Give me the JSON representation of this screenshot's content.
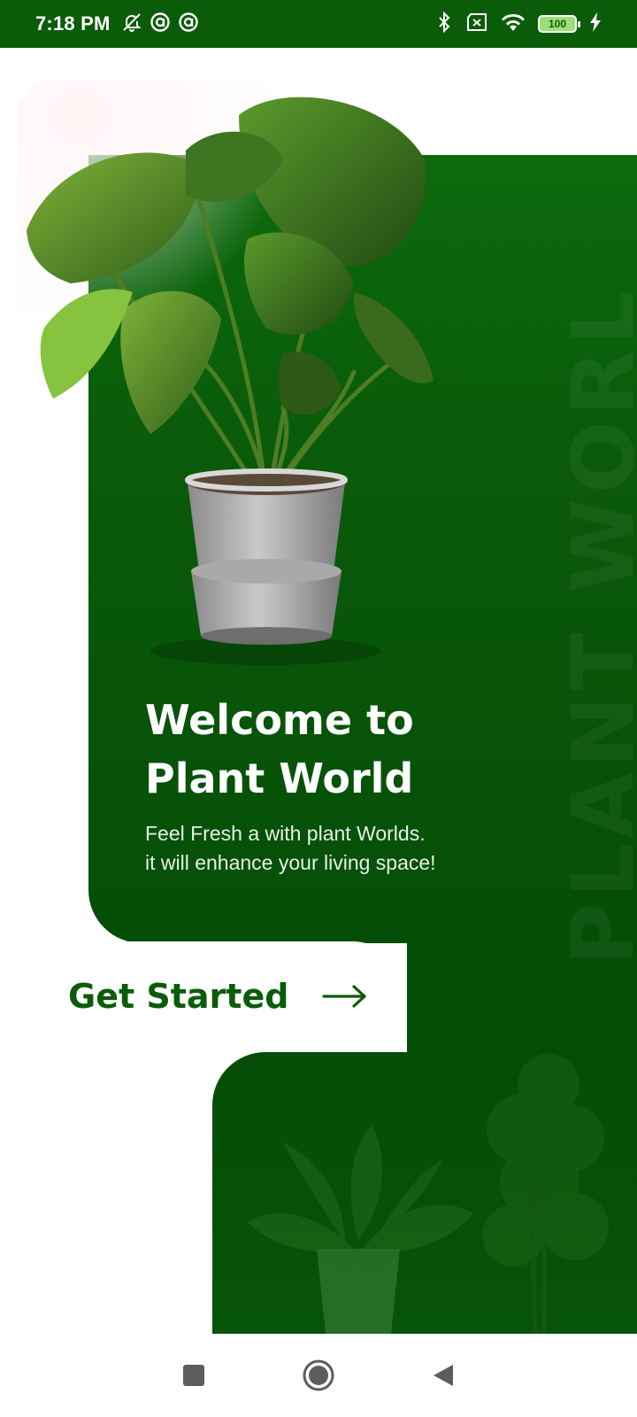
{
  "status_bar": {
    "time": "7:18 PM",
    "battery_level": "100",
    "icons": [
      "mute-bell-icon",
      "circle-a-icon",
      "circle-a-icon",
      "bluetooth-icon",
      "sim-x-icon",
      "wifi-icon",
      "battery-icon",
      "charging-icon"
    ]
  },
  "hero": {
    "title_line1": "Welcome to",
    "title_line2": "Plant World",
    "subtitle_line1": "Feel Fresh a with plant Worlds.",
    "subtitle_line2": "it will enhance your living space!"
  },
  "watermark": "PLANT WORL",
  "cta": {
    "label": "Get Started",
    "icon": "arrow-right-icon"
  },
  "nav": {
    "icons": [
      "recents-square-icon",
      "home-circle-icon",
      "back-triangle-icon"
    ]
  },
  "colors": {
    "brand_green": "#0b5c08",
    "panel_dark": "#054e08",
    "text_white": "#ffffff"
  }
}
